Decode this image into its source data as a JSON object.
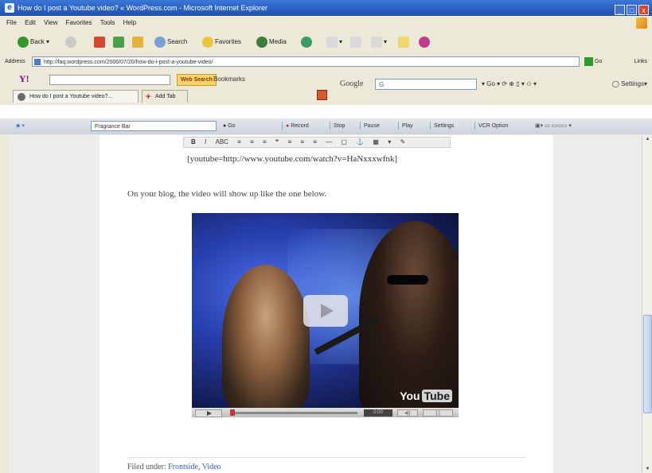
{
  "window": {
    "title": "How do I post a Youtube video? « WordPress.com - Microsoft Internet Explorer",
    "controls": [
      "_",
      "□",
      "x"
    ]
  },
  "menu": [
    "File",
    "Edit",
    "View",
    "Favorites",
    "Tools",
    "Help"
  ],
  "toolbar": {
    "back": "Back",
    "search": "Search",
    "favorites": "Favorites",
    "media": "Media"
  },
  "address": {
    "label": "Address",
    "url": "http://faq.wordpress.com/2006/07/20/how-do-i-post-a-youtube-video/",
    "go": "Go",
    "links": "Links"
  },
  "yahoo": {
    "logo": "Y!",
    "web_search": "Web Search",
    "bookmarks": "Bookmarks"
  },
  "google": {
    "label": "Google",
    "query": "G",
    "go": "Go",
    "settings": "Settings"
  },
  "tabs": {
    "active": "How do I post a Youtube video?...",
    "add": "Add Tab"
  },
  "recorder": {
    "dropdown": "Fragrance Bar",
    "go": "Go",
    "record": "Record",
    "stop": "Stop",
    "pause": "Pause",
    "play": "Play",
    "settings": "Settings",
    "options": "VCR Option"
  },
  "post": {
    "editor_buttons": [
      "B",
      "I",
      "ABC",
      "≡",
      "≡",
      "≡",
      "❝",
      "≡",
      "≡",
      "≡",
      "—",
      "▢",
      "⚓",
      "▦",
      "▾",
      "✎"
    ],
    "code": "[youtube=http://www.youtube.com/watch?v=HaNxxxwfnk]",
    "paragraph": "On your blog, the video will show up like the one below.",
    "video_logo_you": "You",
    "video_logo_tube": "Tube",
    "video_time": "0:00",
    "filed_label": "Filed under: ",
    "filed_links": "Frontside, Video"
  }
}
